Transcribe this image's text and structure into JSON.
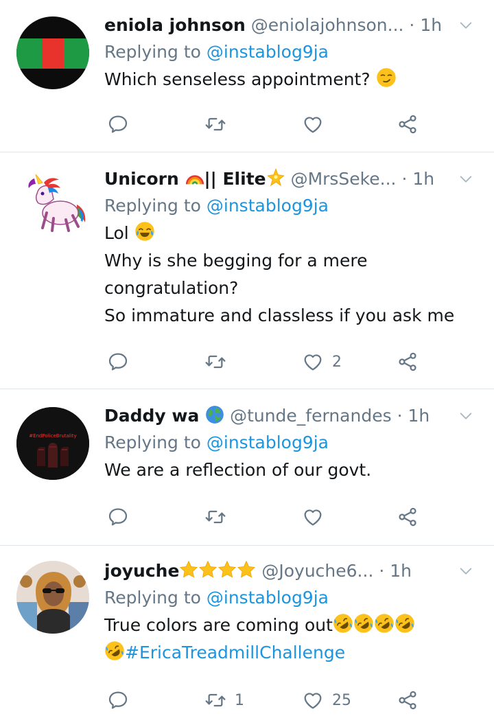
{
  "tweets": [
    {
      "name": "eniola johnson",
      "handle": "@eniolajohnson...",
      "time": "· 1h",
      "replying_prefix": "Replying to ",
      "replying_to": "@instablog9ja",
      "lines": [
        "Which senseless appointment?"
      ],
      "reply_count": "",
      "retweet_count": "",
      "like_count": ""
    },
    {
      "name": "Unicorn",
      "name_suffix": "|| Elite",
      "handle": "@MrsSeke...",
      "time": "· 1h",
      "replying_prefix": "Replying to ",
      "replying_to": "@instablog9ja",
      "lines": [
        "Lol",
        "Why is she begging for a mere",
        "congratulation?",
        "So immature and classless if you ask me"
      ],
      "reply_count": "",
      "retweet_count": "",
      "like_count": "2"
    },
    {
      "name": "Daddy wa",
      "handle": "@tunde_fernandes",
      "time": "· 1h",
      "replying_prefix": "Replying to ",
      "replying_to": "@instablog9ja",
      "avatar_text": "#EndPoliceBrutality",
      "lines": [
        "We are a reflection of our govt."
      ],
      "reply_count": "",
      "retweet_count": "",
      "like_count": ""
    },
    {
      "name": "joyuche",
      "handle": "@Joyuche6...",
      "time": "· 1h",
      "replying_prefix": "Replying to ",
      "replying_to": "@instablog9ja",
      "lines": [
        "True colors are coming out"
      ],
      "hashtag": "#EricaTreadmillChallenge",
      "reply_count": "",
      "retweet_count": "1",
      "like_count": "25"
    }
  ],
  "icons": [
    "reply-icon",
    "retweet-icon",
    "like-icon",
    "share-icon",
    "chevron-down-icon"
  ],
  "colors": {
    "link": "#1b95e0",
    "secondary": "#657786",
    "divider": "#dfe4e8"
  }
}
